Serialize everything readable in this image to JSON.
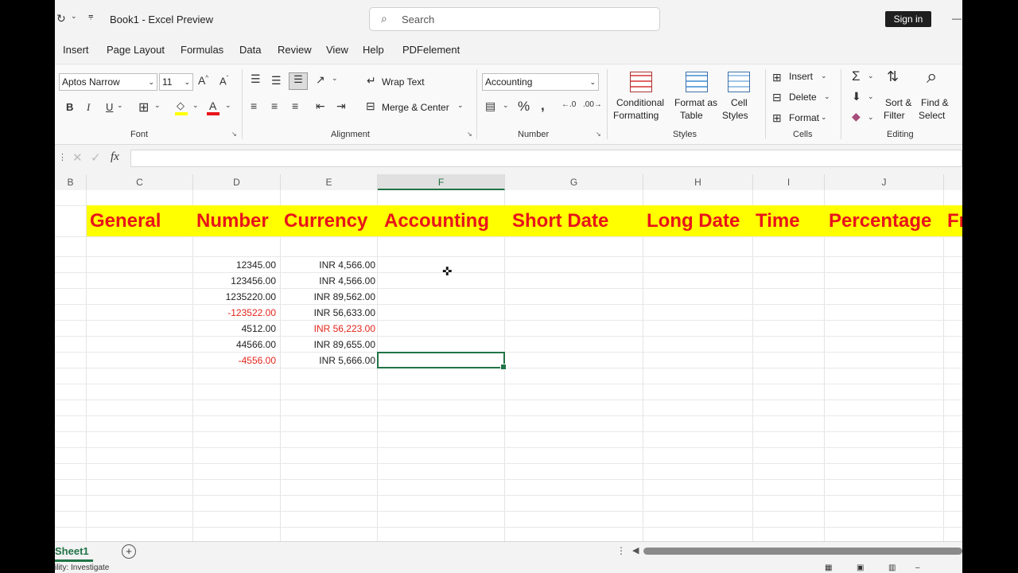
{
  "titlebar": {
    "title": "Book1 - Excel Preview",
    "search_placeholder": "Search",
    "signin": "Sign in"
  },
  "menu": [
    "Insert",
    "Page Layout",
    "Formulas",
    "Data",
    "Review",
    "View",
    "Help",
    "PDFelement"
  ],
  "ribbon": {
    "font": {
      "name": "Aptos Narrow",
      "size": "11",
      "label": "Font"
    },
    "alignment": {
      "wrap": "Wrap Text",
      "merge": "Merge & Center",
      "label": "Alignment"
    },
    "number": {
      "format": "Accounting",
      "label": "Number"
    },
    "styles": {
      "conditional_1": "Conditional",
      "conditional_2": "Formatting",
      "fmt_table_1": "Format as",
      "fmt_table_2": "Table",
      "cell_styles_1": "Cell",
      "cell_styles_2": "Styles",
      "label": "Styles"
    },
    "cells": {
      "insert": "Insert",
      "delete": "Delete",
      "format": "Format",
      "label": "Cells"
    },
    "editing": {
      "sort_1": "Sort &",
      "sort_2": "Filter",
      "find_1": "Find &",
      "find_2": "Select",
      "label": "Editing"
    }
  },
  "formula_bar": {
    "fx": "fx"
  },
  "columns": [
    "B",
    "C",
    "D",
    "E",
    "F",
    "G",
    "H",
    "I",
    "J"
  ],
  "headers": [
    "General",
    "Number",
    "Currency",
    "Accounting",
    "Short Date",
    "Long Date",
    "Time",
    "Percentage",
    "Fr"
  ],
  "number_col": [
    "12345.00",
    "123456.00",
    "1235220.00",
    "-123522.00",
    "4512.00",
    "44566.00",
    "-4556.00"
  ],
  "currency_col": [
    "INR 4,566.00",
    "INR 4,566.00",
    "INR 89,562.00",
    "INR 56,633.00",
    "INR 56,223.00",
    "INR 89,655.00",
    "INR 5,666.00"
  ],
  "sheet_tab": "Sheet1",
  "status_text": "ility: Investigate",
  "colors": {
    "header_fill": "#ffff00",
    "header_text": "#e8141a",
    "negative": "#e3261b",
    "selection": "#217346"
  }
}
